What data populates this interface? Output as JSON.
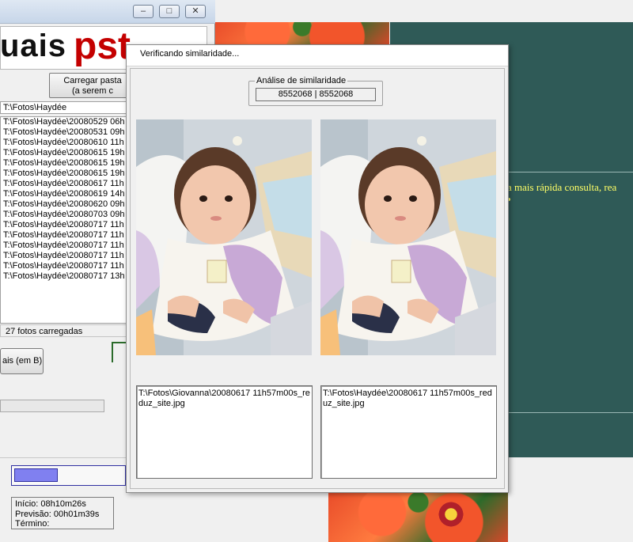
{
  "main_window": {
    "logo_left": "uais",
    "logo_right": "pst",
    "minimize_glyph": "–",
    "maximize_glyph": "□",
    "close_glyph": "✕",
    "load_button_line1": "Carregar pasta",
    "load_button_line2": "(a serem c",
    "current_path": "T:\\Fotos\\Haydée",
    "files": [
      "T:\\Fotos\\Haydée\\20080529 06h",
      "T:\\Fotos\\Haydée\\20080531 09h",
      "T:\\Fotos\\Haydée\\20080610 11h",
      "T:\\Fotos\\Haydée\\20080615 19h",
      "T:\\Fotos\\Haydée\\20080615 19h",
      "T:\\Fotos\\Haydée\\20080615 19h",
      "T:\\Fotos\\Haydée\\20080617 11h",
      "T:\\Fotos\\Haydée\\20080619 14h",
      "T:\\Fotos\\Haydée\\20080620 09h",
      "T:\\Fotos\\Haydée\\20080703 09h",
      "T:\\Fotos\\Haydée\\20080717 11h",
      "T:\\Fotos\\Haydée\\20080717 11h",
      "T:\\Fotos\\Haydée\\20080717 11h",
      "T:\\Fotos\\Haydée\\20080717 11h",
      "T:\\Fotos\\Haydée\\20080717 11h",
      "T:\\Fotos\\Haydée\\20080717 13h"
    ],
    "status_count": "27 fotos carregadas",
    "b_button_label": "ais (em B)",
    "progress_fraction": 0.4,
    "time_start": "Início:   08h10m26s",
    "time_forecast": "Previsão: 00h01m39s",
    "time_end": "Término:"
  },
  "background": {
    "teal_text": "a mais rápida consulta, rea",
    "teal_color": "#2f5a57",
    "text_color": "#ffff66"
  },
  "dialog": {
    "title": "Verificando similaridade...",
    "group_label": "Análise de similaridade",
    "similarity_value": "8552068 | 8552068",
    "left_path": "T:\\Fotos\\Giovanna\\20080617 11h57m00s_reduz_site.jpg",
    "right_path": "T:\\Fotos\\Haydée\\20080617 11h57m00s_reduz_site.jpg"
  }
}
